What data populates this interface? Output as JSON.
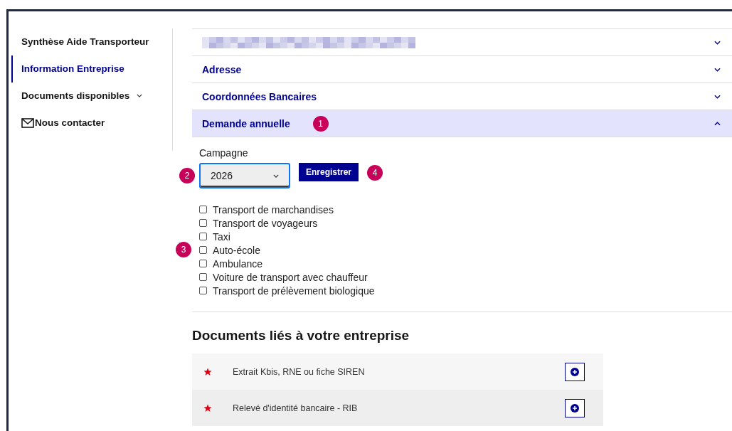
{
  "sidebar": {
    "items": [
      {
        "label": "Synthèse Aide Transporteur",
        "kind": "link",
        "selected": false
      },
      {
        "label": "Information Entreprise",
        "kind": "link",
        "selected": true
      },
      {
        "label": "Documents disponibles",
        "kind": "menu",
        "selected": false,
        "expanded": false
      },
      {
        "label": "Nous contacter",
        "kind": "mail",
        "selected": false
      }
    ]
  },
  "accordion": [
    {
      "kind": "redacted",
      "expanded": false
    },
    {
      "kind": "text",
      "title": "Adresse",
      "expanded": false
    },
    {
      "kind": "text",
      "title": "Coordonnées Bancaires",
      "expanded": false
    },
    {
      "kind": "text",
      "title": "Demande annuelle",
      "expanded": true,
      "badge": "1"
    }
  ],
  "campagne": {
    "label": "Campagne",
    "value": "2026",
    "badge": "2"
  },
  "save_button": {
    "label": "Enregistrer",
    "badge": "4"
  },
  "activities": [
    {
      "label": "Transport de marchandises",
      "checked": false
    },
    {
      "label": "Transport de voyageurs",
      "checked": false
    },
    {
      "label": "Taxi",
      "checked": false
    },
    {
      "label": "Auto-école",
      "checked": false,
      "badge": "3"
    },
    {
      "label": "Ambulance",
      "checked": false
    },
    {
      "label": "Voiture de transport avec chauffeur",
      "checked": false
    },
    {
      "label": "Transport de prélèvement biologique",
      "checked": false
    }
  ],
  "documents": {
    "title": "Documents liés à votre entreprise",
    "rows": [
      {
        "label": "Extrait Kbis, RNE ou fiche SIREN",
        "required": true
      },
      {
        "label": "Relevé d'identité bancaire - RIB",
        "required": true
      }
    ]
  }
}
